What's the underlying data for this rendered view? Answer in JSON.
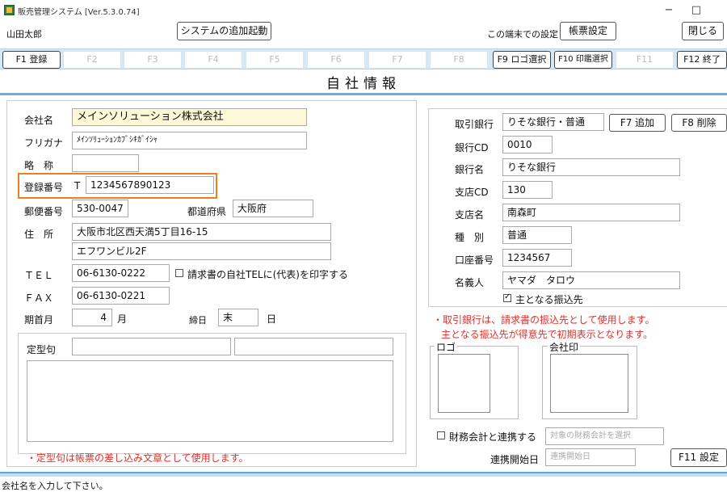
{
  "window": {
    "title": "販売管理システム [Ver.5.3.0.74]",
    "minimize": "−",
    "maximize": "□"
  },
  "topbar": {
    "user": "山田太郎",
    "launch_button": "システムの追加起動",
    "terminal_setting_label": "この端末での設定",
    "form_setting_button": "帳票設定",
    "close_button": "閉じる"
  },
  "fkeys": [
    {
      "label": "F1 登録",
      "enabled": true
    },
    {
      "label": "F2",
      "enabled": false
    },
    {
      "label": "F3",
      "enabled": false
    },
    {
      "label": "F4",
      "enabled": false
    },
    {
      "label": "F5",
      "enabled": false
    },
    {
      "label": "F6",
      "enabled": false
    },
    {
      "label": "F7",
      "enabled": false
    },
    {
      "label": "F8",
      "enabled": false
    },
    {
      "label": "F9 ロゴ選択",
      "enabled": true
    },
    {
      "label": "F10 印鑑選択",
      "enabled": true
    },
    {
      "label": "F11",
      "enabled": false
    },
    {
      "label": "F12 終了",
      "enabled": true
    }
  ],
  "page_title": "自社情報",
  "company": {
    "name_label": "会社名",
    "name_value": "メインソリューション株式会社",
    "kana_label": "フリガナ",
    "kana_value": "ﾒｲﾝｿﾘｭｰｼｮﾝｶﾌﾞｼｷｶﾞｲｼｬ",
    "abbr_label": "略　称",
    "abbr_value": "",
    "regno_label": "登録番号",
    "regno_prefix": "T",
    "regno_value": "1234567890123",
    "zip_label": "郵便番号",
    "zip_value": "530-0047",
    "pref_label": "都道府県",
    "pref_value": "大阪府",
    "address_label": "住　所",
    "address1": "大阪市北区西天満5丁目16-15",
    "address2": "エフワンビル2F",
    "tel_label": "ＴＥＬ",
    "tel_value": "06-6130-0222",
    "tel_print_label": "請求書の自社TELに(代表)を印字する",
    "fax_label": "ＦＡＸ",
    "fax_value": "06-6130-0221",
    "fiscal_label": "期首月",
    "fiscal_value": "4",
    "fiscal_unit": "月",
    "closing_label": "締日",
    "closing_value": "末",
    "closing_unit": "日"
  },
  "phrase": {
    "label": "定型句",
    "value1": "",
    "value2": "",
    "body": "",
    "note": "・定型句は帳票の差し込み文章として使用します。"
  },
  "bank": {
    "bank_label": "取引銀行",
    "bank_value": "りそな銀行・普通",
    "add_button": "F7 追加",
    "delete_button": "F8 削除",
    "code_label": "銀行CD",
    "code_value": "0010",
    "name_label": "銀行名",
    "name_value": "りそな銀行",
    "branch_code_label": "支店CD",
    "branch_code_value": "130",
    "branch_label": "支店名",
    "branch_value": "南森町",
    "type_label": "種　別",
    "type_value": "普通",
    "account_label": "口座番号",
    "account_value": "1234567",
    "holder_label": "名義人",
    "holder_value": "ヤマダ　タロウ",
    "main_label": "主となる振込先",
    "note1": "・取引銀行は、請求書の振込先として使用します。",
    "note2": "主となる振込先が得意先で初期表示となります。"
  },
  "images": {
    "logo_label": "ロゴ",
    "seal_label": "会社印"
  },
  "accounting": {
    "link_label": "財務会計と連携する",
    "target_placeholder": "対象の財務会計を選択",
    "start_label": "連携開始日",
    "start_placeholder": "連携開始日",
    "setting_button": "F11 設定"
  },
  "status": "会社名を入力して下さい。"
}
